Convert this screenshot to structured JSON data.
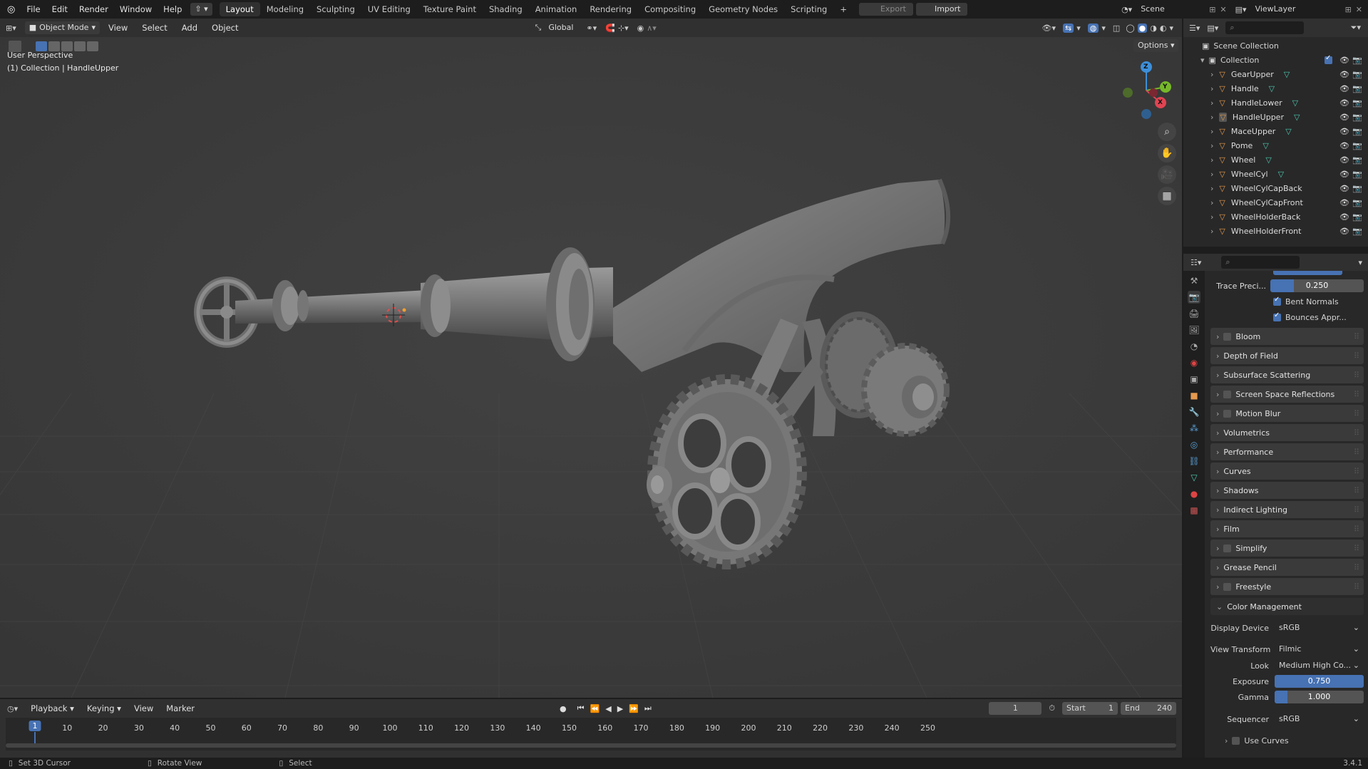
{
  "topbar": {
    "menus": [
      "File",
      "Edit",
      "Render",
      "Window",
      "Help"
    ],
    "workspaces": [
      "Layout",
      "Modeling",
      "Sculpting",
      "UV Editing",
      "Texture Paint",
      "Shading",
      "Animation",
      "Rendering",
      "Compositing",
      "Geometry Nodes",
      "Scripting"
    ],
    "active_workspace": "Layout",
    "add_tab": "+",
    "export_label": "Export",
    "import_label": "Import",
    "scene": "Scene",
    "view_layer": "ViewLayer"
  },
  "viewport_header": {
    "mode": "Object Mode",
    "menus": [
      "View",
      "Select",
      "Add",
      "Object"
    ],
    "orientation": "Global",
    "options": "Options"
  },
  "viewport": {
    "perspective_label": "User Perspective",
    "context_label": "(1) Collection | HandleUpper",
    "axes": {
      "z": "Z",
      "y": "Y",
      "x": "X"
    }
  },
  "outliner": {
    "scene_collection": "Scene Collection",
    "collection": "Collection",
    "items": [
      {
        "name": "GearUpper",
        "has_mesh": true
      },
      {
        "name": "Handle",
        "has_mesh": true
      },
      {
        "name": "HandleLower",
        "has_mesh": true
      },
      {
        "name": "HandleUpper",
        "has_mesh": true,
        "active": true
      },
      {
        "name": "MaceUpper",
        "has_mesh": true
      },
      {
        "name": "Pome",
        "has_mesh": true
      },
      {
        "name": "Wheel",
        "has_mesh": true
      },
      {
        "name": "WheelCyl",
        "has_mesh": true
      },
      {
        "name": "WheelCylCapBack",
        "has_mesh": false
      },
      {
        "name": "WheelCylCapFront",
        "has_mesh": false
      },
      {
        "name": "WheelHolderBack",
        "has_mesh": false
      },
      {
        "name": "WheelHolderFront",
        "has_mesh": false
      }
    ]
  },
  "properties": {
    "trace_precision_label": "Trace Preci...",
    "trace_precision_value": "0.250",
    "bent_normals": "Bent Normals",
    "bounces_approx": "Bounces Appr...",
    "panels": [
      {
        "label": "Bloom",
        "has_checkbox": true
      },
      {
        "label": "Depth of Field",
        "has_checkbox": false
      },
      {
        "label": "Subsurface Scattering",
        "has_checkbox": false
      },
      {
        "label": "Screen Space Reflections",
        "has_checkbox": true
      },
      {
        "label": "Motion Blur",
        "has_checkbox": true
      },
      {
        "label": "Volumetrics",
        "has_checkbox": false
      },
      {
        "label": "Performance",
        "has_checkbox": false
      },
      {
        "label": "Curves",
        "has_checkbox": false
      },
      {
        "label": "Shadows",
        "has_checkbox": false
      },
      {
        "label": "Indirect Lighting",
        "has_checkbox": false
      },
      {
        "label": "Film",
        "has_checkbox": false
      },
      {
        "label": "Simplify",
        "has_checkbox": true
      },
      {
        "label": "Grease Pencil",
        "has_checkbox": false
      },
      {
        "label": "Freestyle",
        "has_checkbox": true
      }
    ],
    "color_management": {
      "title": "Color Management",
      "display_device_label": "Display Device",
      "display_device": "sRGB",
      "view_transform_label": "View Transform",
      "view_transform": "Filmic",
      "look_label": "Look",
      "look": "Medium High Co...",
      "exposure_label": "Exposure",
      "exposure": "0.750",
      "gamma_label": "Gamma",
      "gamma": "1.000",
      "sequencer_label": "Sequencer",
      "sequencer": "sRGB",
      "use_curves": "Use Curves"
    }
  },
  "timeline": {
    "menus": [
      "Playback",
      "Keying",
      "View",
      "Marker"
    ],
    "current_frame": "1",
    "start_label": "Start",
    "start": "1",
    "end_label": "End",
    "end": "240",
    "ticks": [
      "1",
      "10",
      "20",
      "30",
      "40",
      "50",
      "60",
      "70",
      "80",
      "90",
      "100",
      "110",
      "120",
      "130",
      "140",
      "150",
      "160",
      "170",
      "180",
      "190",
      "200",
      "210",
      "220",
      "230",
      "240",
      "250"
    ]
  },
  "statusbar": {
    "set_cursor": "Set 3D Cursor",
    "rotate": "Rotate View",
    "select": "Select",
    "version": "3.4.1"
  },
  "colors": {
    "accent": "#4772b3",
    "active_frame": "#4772b3",
    "x_axis": "#e04452",
    "y_axis": "#76b82a",
    "z_axis": "#3d8fd9",
    "mesh_icon": "#4ec9b0",
    "object_icon": "#e59a4f"
  }
}
